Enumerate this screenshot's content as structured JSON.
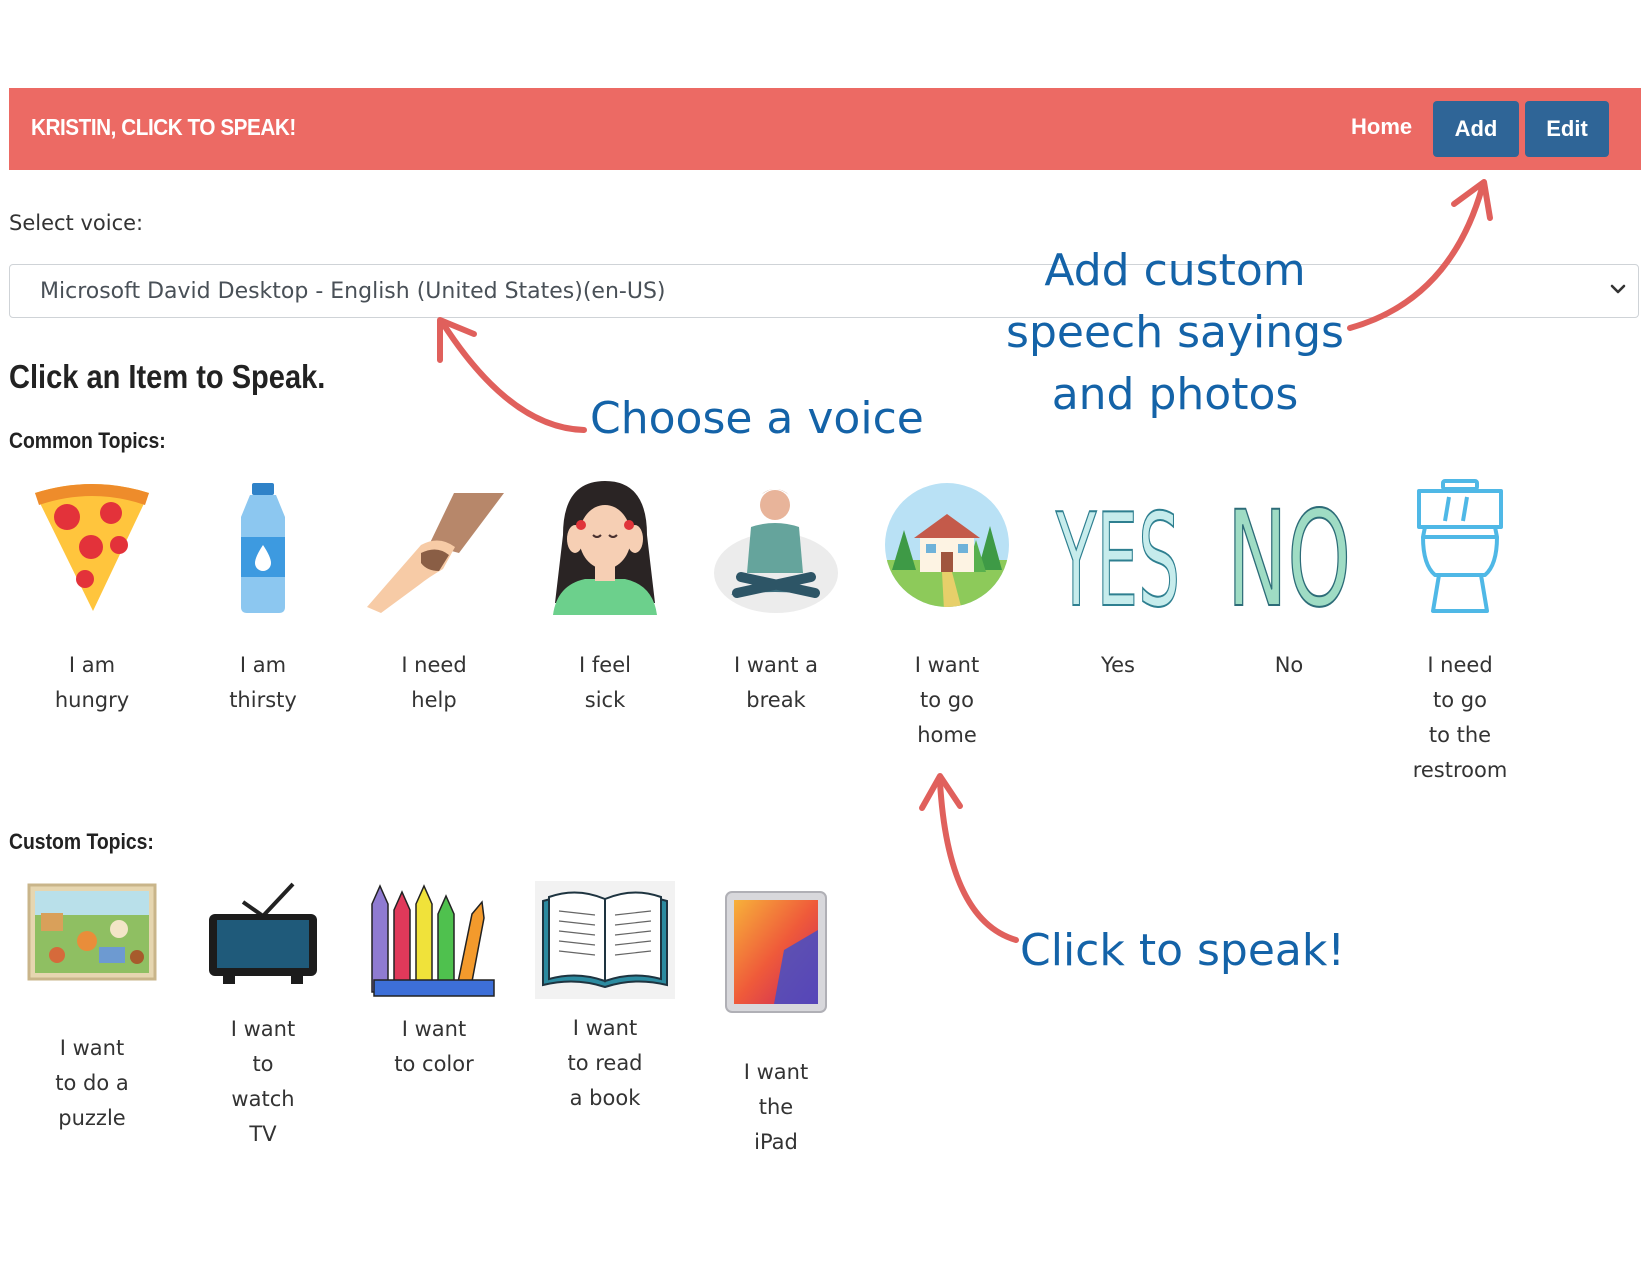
{
  "navbar": {
    "brand": "KRISTIN, CLICK TO SPEAK!",
    "home_label": "Home",
    "add_label": "Add",
    "edit_label": "Edit",
    "bar_color": "#ec6a64",
    "button_color": "#2f6597"
  },
  "voice": {
    "label": "Select voice:",
    "selected": "Microsoft David Desktop - English (United States)(en-US)"
  },
  "page_title": "Click an Item to Speak.",
  "common": {
    "label": "Common Topics:",
    "items": [
      {
        "caption": "I am\nhungry",
        "icon": "pizza-icon"
      },
      {
        "caption": "I am\nthirsty",
        "icon": "water-bottle-icon"
      },
      {
        "caption": "I need\nhelp",
        "icon": "helping-hand-icon"
      },
      {
        "caption": "I feel\nsick",
        "icon": "sick-person-icon"
      },
      {
        "caption": "I want a\nbreak",
        "icon": "meditating-person-icon"
      },
      {
        "caption": "I want\nto go\nhome",
        "icon": "house-icon"
      },
      {
        "caption": "Yes",
        "icon": "yes-icon"
      },
      {
        "caption": "No",
        "icon": "no-icon"
      },
      {
        "caption": "I need\nto go\nto the\nrestroom",
        "icon": "toilet-icon"
      }
    ]
  },
  "custom": {
    "label": "Custom Topics:",
    "items": [
      {
        "caption": "I want\nto do a\npuzzle",
        "icon": "puzzle-icon"
      },
      {
        "caption": "I want\nto\nwatch\nTV",
        "icon": "tv-icon"
      },
      {
        "caption": "I want\nto color",
        "icon": "crayons-icon"
      },
      {
        "caption": "I want\nto read\na book",
        "icon": "book-icon"
      },
      {
        "caption": "I want\nthe\niPad",
        "icon": "ipad-icon"
      }
    ]
  },
  "icon_text": {
    "yes": "YES",
    "no": "NO"
  },
  "annotations": {
    "add_custom_line1": "Add custom",
    "add_custom_line2": "speech sayings",
    "add_custom_line3": "and photos",
    "choose_voice": "Choose a voice",
    "click_to_speak": "Click to speak!",
    "text_color": "#1463a8",
    "arrow_color": "#e0605c"
  }
}
